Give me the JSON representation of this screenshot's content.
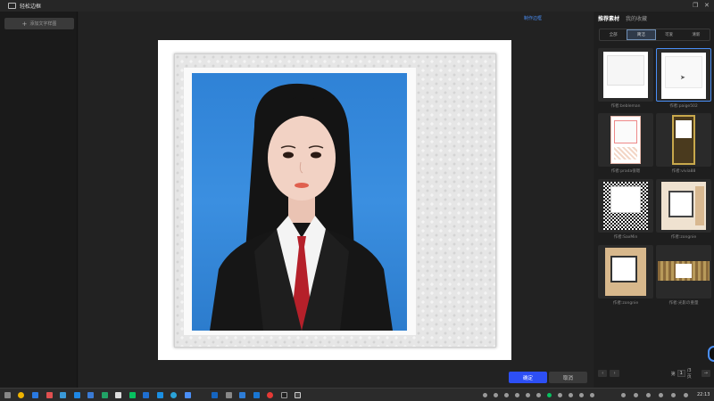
{
  "window": {
    "title": "轻松边框",
    "restore_icon": "restore-icon",
    "close_icon": "close-icon"
  },
  "left_panel": {
    "add_text_label": "添加文字样图"
  },
  "canvas": {
    "edit_border_label": "制作边框",
    "confirm_label": "确定",
    "cancel_label": "取消"
  },
  "right_panel": {
    "tabs": [
      {
        "label": "推荐素材",
        "active": true
      },
      {
        "label": "我的收藏",
        "active": false
      }
    ],
    "filters": [
      {
        "label": "全部",
        "active": false
      },
      {
        "label": "简洁",
        "active": true
      },
      {
        "label": "可爱",
        "active": false
      },
      {
        "label": "清新",
        "active": false
      }
    ],
    "templates": [
      {
        "author": "作者:bebleman",
        "selected": false
      },
      {
        "author": "作者:paige502",
        "selected": true
      },
      {
        "author": "作者:prada很嗯",
        "selected": false
      },
      {
        "author": "作者:vivia88",
        "selected": false
      },
      {
        "author": "作者:SaxMin",
        "selected": false
      },
      {
        "author": "作者:zongnie",
        "selected": false
      },
      {
        "author": "作者:zongnie",
        "selected": false
      },
      {
        "author": "作者:光影の重量",
        "selected": false
      }
    ],
    "pager": {
      "prev": "‹",
      "next": "›",
      "page_prefix": "第",
      "page": "1",
      "total_suffix": "/3 页",
      "go": "→"
    }
  },
  "taskbar": {
    "clock": "22:13"
  },
  "colors": {
    "accent": "#2d4ff5",
    "link": "#4a8ff7",
    "photo_bg": "#3b8fe0",
    "tie": "#b5202a"
  }
}
